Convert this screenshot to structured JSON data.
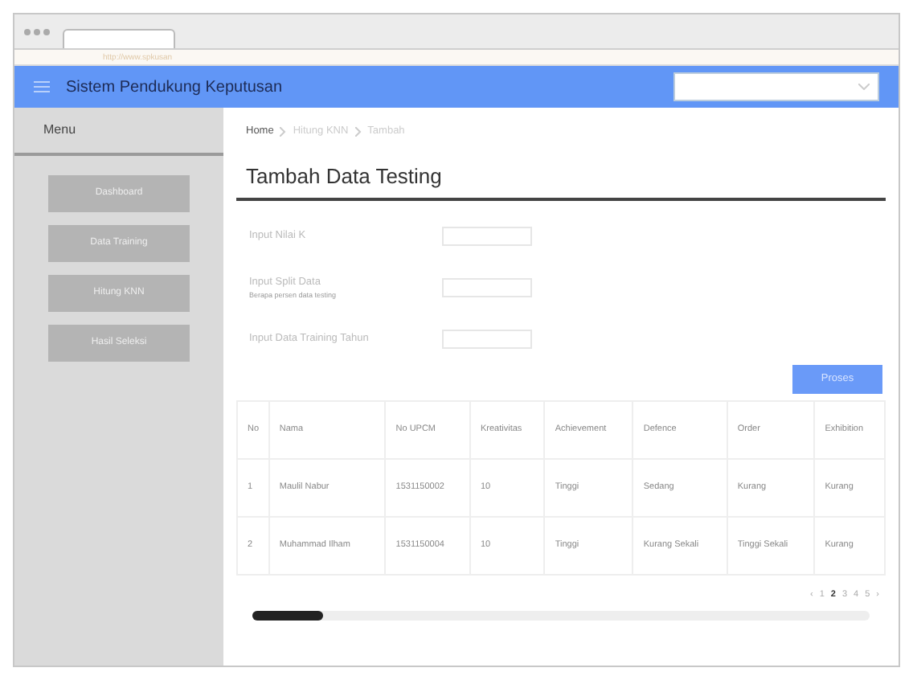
{
  "browser": {
    "url": "http://www.spkusan"
  },
  "header": {
    "title": "Sistem Pendukung Keputusan"
  },
  "sidebar": {
    "title": "Menu",
    "items": [
      {
        "label": "Dashboard"
      },
      {
        "label": "Data Training"
      },
      {
        "label": "Hitung KNN"
      },
      {
        "label": "Hasil Seleksi"
      }
    ]
  },
  "breadcrumb": [
    {
      "label": "Home",
      "current": true
    },
    {
      "label": "Hitung KNN",
      "current": false
    },
    {
      "label": "Tambah",
      "current": false
    }
  ],
  "page_title": "Tambah Data Testing",
  "form": [
    {
      "label": "Input Nilai K"
    },
    {
      "label": "Input Split Data",
      "hint": "Berapa persen data testing"
    },
    {
      "label": "Input Data Training Tahun"
    }
  ],
  "submit": "Proses",
  "table": {
    "columns": [
      "No",
      "Nama",
      "No UPCM",
      "Kreativitas",
      "Achievement",
      "Defence",
      "Order",
      "Exhibition"
    ],
    "rows": [
      [
        "1",
        "Maulil Nabur",
        "1531150002",
        "10",
        "Tinggi",
        "Sedang",
        "Kurang",
        "Kurang"
      ],
      [
        "2",
        "Muhammad Ilham",
        "1531150004",
        "10",
        "Tinggi",
        "Kurang Sekali",
        "Tinggi Sekali",
        "Kurang"
      ]
    ]
  },
  "pagination": [
    {
      "label": "‹",
      "selected": false
    },
    {
      "label": "1",
      "selected": false
    },
    {
      "label": "2",
      "selected": true
    },
    {
      "label": "3",
      "selected": false
    },
    {
      "label": "4",
      "selected": false
    },
    {
      "label": "5",
      "selected": false
    },
    {
      "label": "›",
      "selected": false
    }
  ]
}
